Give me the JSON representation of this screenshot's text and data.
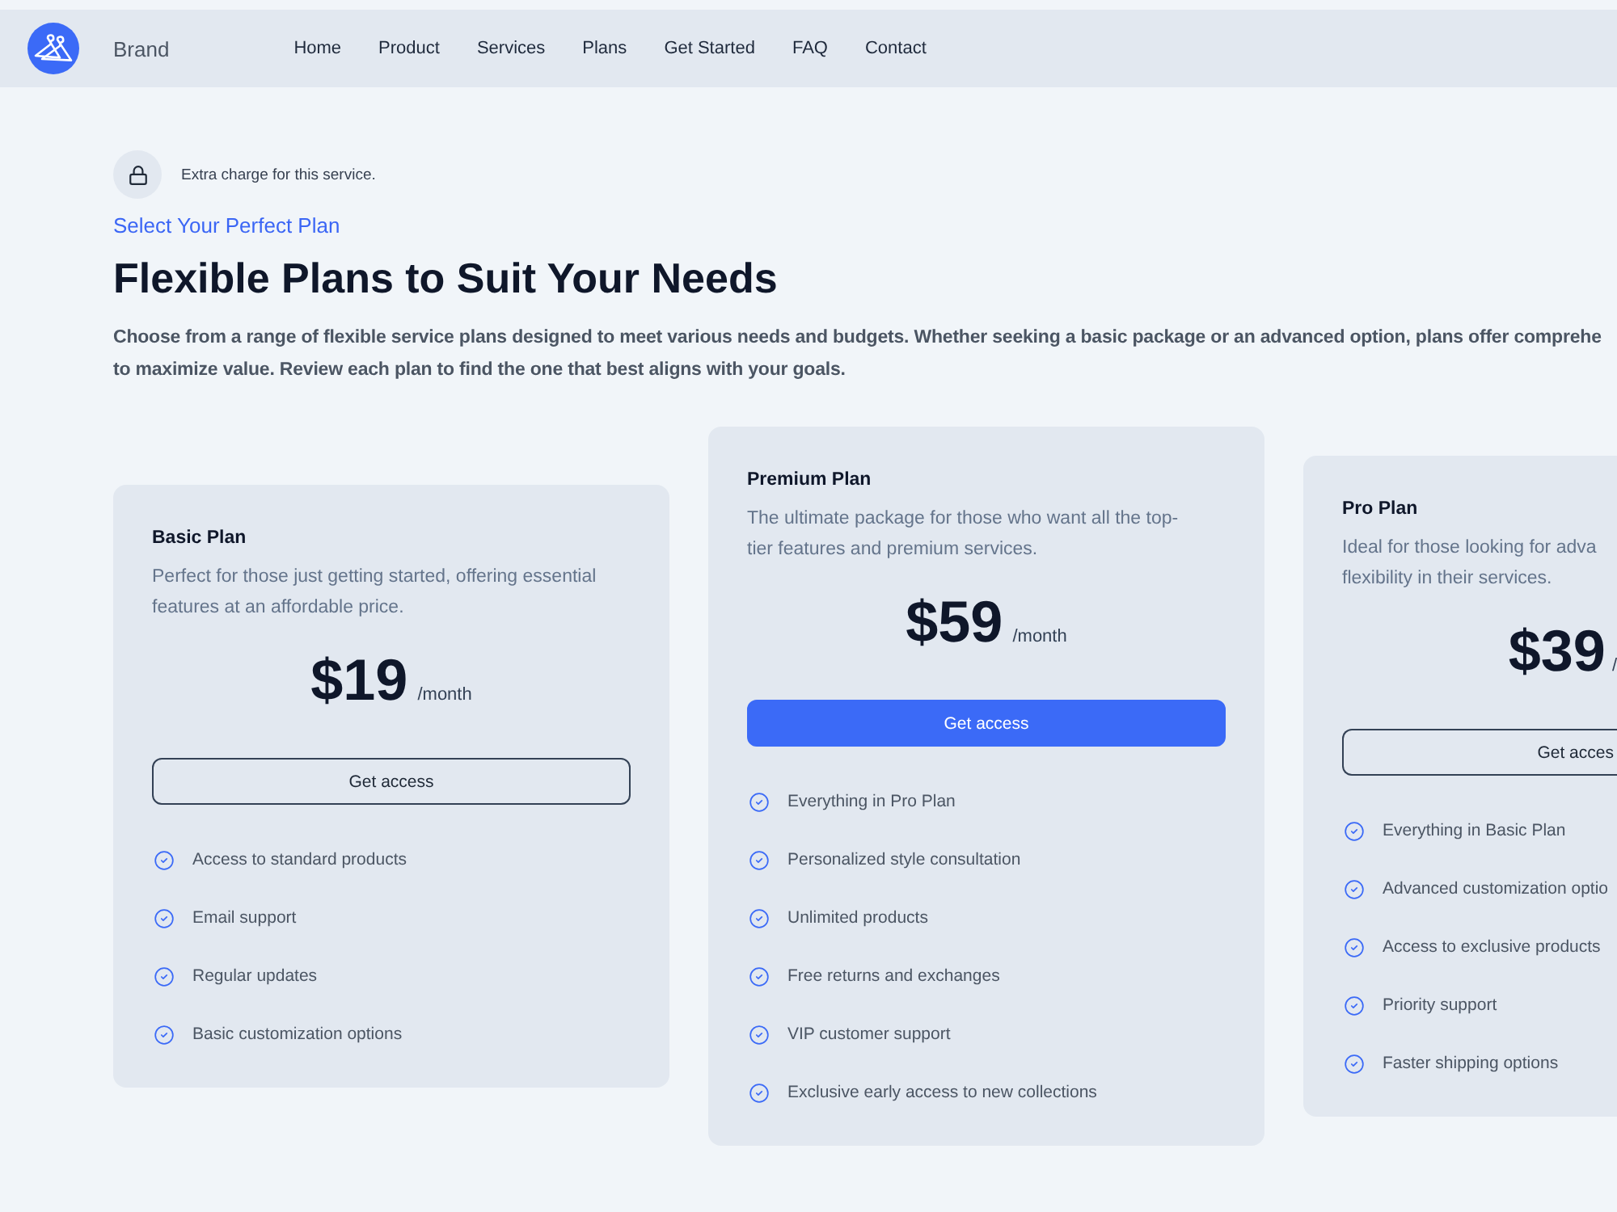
{
  "nav": {
    "brand": "Brand",
    "links": [
      "Home",
      "Product",
      "Services",
      "Plans",
      "Get Started",
      "FAQ",
      "Contact"
    ]
  },
  "notice": {
    "text": "Extra charge for this service."
  },
  "eyebrow": "Select Your Perfect Plan",
  "heading": "Flexible Plans to Suit Your Needs",
  "intro_lines": [
    "Choose from a range of flexible service plans designed to meet various needs and budgets. Whether seeking a basic package or an advanced option, plans offer comprehe",
    "to maximize value. Review each plan to find the one that best aligns with your goals."
  ],
  "plans": [
    {
      "name": "Basic Plan",
      "description_lines": [
        "Perfect for those just getting started, offering essential",
        "features at an affordable price."
      ],
      "price": "$19",
      "period": "/month",
      "button": {
        "label": "Get access",
        "kind": "outline"
      },
      "features": [
        "Access to standard products",
        "Email support",
        "Regular updates",
        "Basic customization options"
      ]
    },
    {
      "name": "Premium Plan",
      "description_lines": [
        "The ultimate package for those who want all the top-",
        "tier features and premium services."
      ],
      "price": "$59",
      "period": "/month",
      "button": {
        "label": "Get access",
        "kind": "primary"
      },
      "features": [
        "Everything in Pro Plan",
        "Personalized style consultation",
        "Unlimited products",
        "Free returns and exchanges",
        "VIP customer support",
        "Exclusive early access to new collections"
      ]
    },
    {
      "name": "Pro Plan",
      "description_lines": [
        "Ideal for those looking for adva",
        "flexibility in their services."
      ],
      "price": "$39",
      "period": "/",
      "button": {
        "label": "Get acces",
        "kind": "outline"
      },
      "features": [
        "Everything in Basic Plan",
        "Advanced customization optio",
        "Access to exclusive products",
        "Priority support",
        "Faster shipping options"
      ]
    }
  ]
}
